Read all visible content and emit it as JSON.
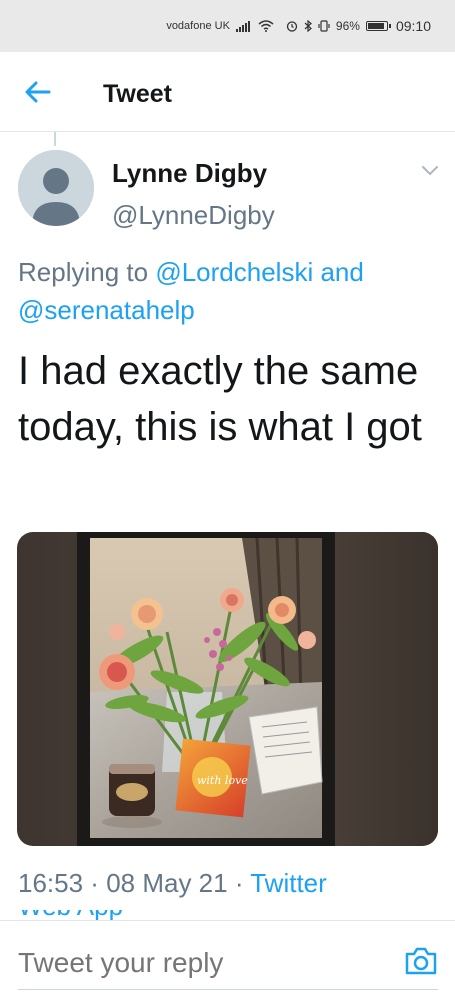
{
  "status_bar": {
    "carrier": "vodafone UK",
    "battery_percent": "96%",
    "battery_level": 0.96,
    "time": "09:10",
    "icons": [
      "signal-icon",
      "wifi-icon",
      "alarm-icon",
      "bluetooth-icon",
      "vibrate-icon",
      "battery-icon"
    ]
  },
  "header": {
    "title": "Tweet",
    "back_icon": "back-arrow-icon"
  },
  "tweet": {
    "display_name": "Lynne Digby",
    "handle": "@LynneDigby",
    "replying_prefix": "Replying to",
    "reply_mention_1": "@Lordchelski",
    "reply_and": "and",
    "reply_mention_2": "@serenatahelp",
    "text": "I had exactly the same today, this is what I got",
    "timestamp_time": "16:53",
    "timestamp_date": "08 May 21",
    "source": "Twitter Web App",
    "photo_card_text": "with love"
  },
  "reply_bar": {
    "placeholder": "Tweet your reply",
    "camera_icon": "camera-icon"
  },
  "colors": {
    "accent": "#1da1f2",
    "secondary_text": "#657786",
    "primary_text": "#14171a",
    "divider": "#e1e8ed"
  }
}
